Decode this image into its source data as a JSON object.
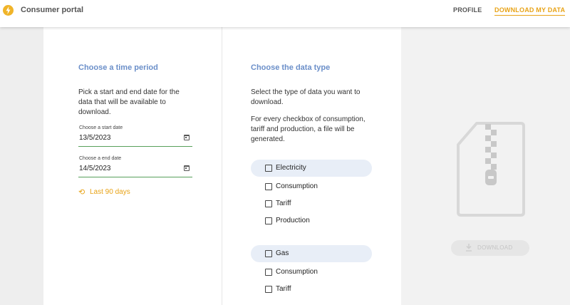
{
  "header": {
    "app_title": "Consumer portal",
    "nav": {
      "profile": "PROFILE",
      "download": "DOWNLOAD MY DATA"
    },
    "logo_icon": "lightning-bolt-icon"
  },
  "time_period": {
    "title": "Choose a time period",
    "description": "Pick a start and end date for the data that will be available to download.",
    "start": {
      "label": "Choose a start date",
      "value": "13/5/2023"
    },
    "end": {
      "label": "Choose a end date",
      "value": "14/5/2023"
    },
    "quick_select": "Last 90 days"
  },
  "data_type": {
    "title": "Choose the data type",
    "description": "Select the type of data you want to download.",
    "note": "For every checkbox of consumption, tariff and production, a file will be generated.",
    "groups": [
      {
        "label": "Electricity",
        "options": [
          "Consumption",
          "Tariff",
          "Production"
        ]
      },
      {
        "label": "Gas",
        "options": [
          "Consumption",
          "Tariff"
        ]
      }
    ]
  },
  "download": {
    "button_label": "DOWNLOAD",
    "icon": "zip-file-icon"
  },
  "colors": {
    "accent": "#e8a317",
    "title_blue": "#6b8fc9",
    "field_underline": "#58a05b",
    "group_bg": "#e8eef7"
  }
}
